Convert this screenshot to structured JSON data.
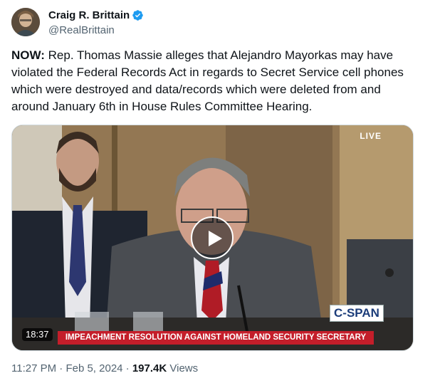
{
  "author": {
    "display_name": "Craig R. Brittain",
    "handle": "@RealBrittain",
    "verified_icon": "verified-badge-icon",
    "badge_color": "#1d9bf0"
  },
  "tweet": {
    "lead": "NOW:",
    "body": " Rep. Thomas Massie alleges that Alejandro Mayorkas may have violated the Federal Records Act in regards to Secret Service cell phones which were destroyed and data/records which were deleted from and around January 6th in House Rules Committee Hearing."
  },
  "video": {
    "live_label": "LIVE",
    "network_logo": "C-SPAN",
    "chyron": "IMPEACHMENT RESOLUTION AGAINST HOMELAND SECURITY SECRETARY",
    "duration": "18:37",
    "play_icon": "play-icon",
    "chyron_color": "#c41e2a"
  },
  "meta": {
    "time": "11:27 PM",
    "separator1": " · ",
    "date": "Feb 5, 2024",
    "separator2": " · ",
    "views_count": "197.4K",
    "views_label": " Views"
  }
}
